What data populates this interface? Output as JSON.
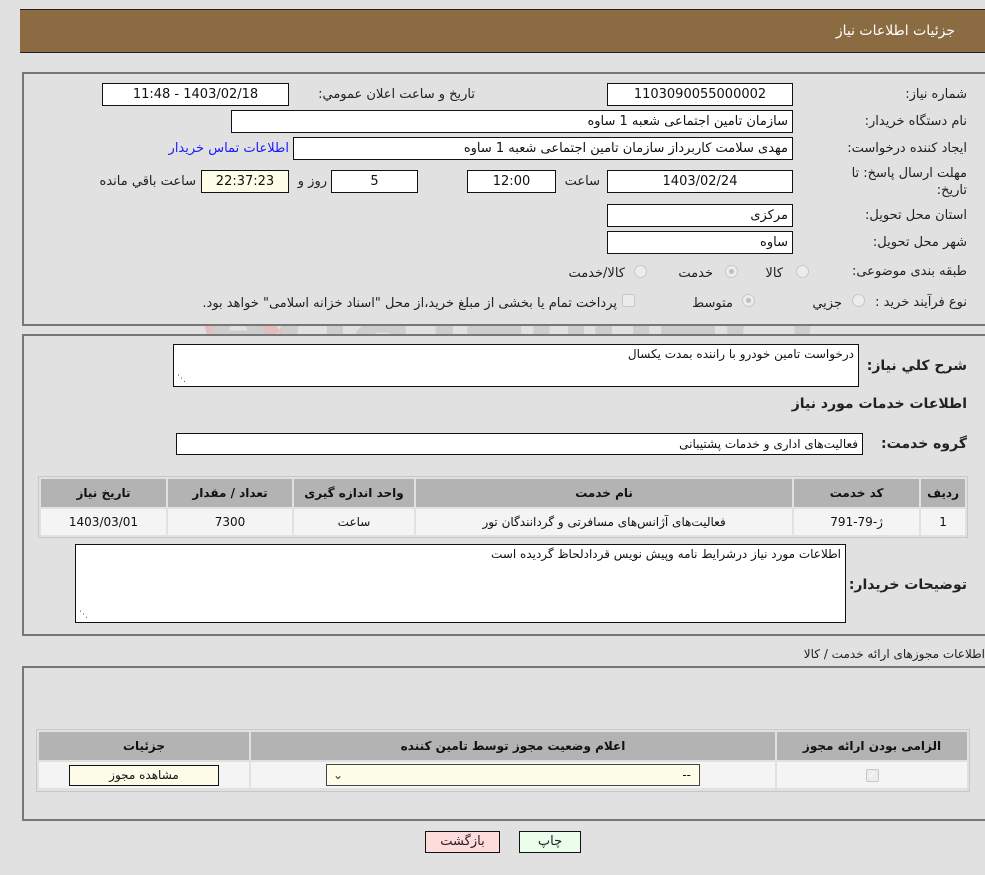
{
  "header": {
    "title": "جزئیات اطلاعات نیاز"
  },
  "details": {
    "need_number_label": "شماره نیاز:",
    "need_number": "1103090055000002",
    "announce_label": "تاریخ و ساعت اعلان عمومي:",
    "announce_value": "1403/02/18 - 11:48",
    "buyer_org_label": "نام دستگاه خریدار:",
    "buyer_org": "سازمان تامین اجتماعی شعبه 1 ساوه",
    "creator_label": "ایجاد کننده درخواست:",
    "creator": "مهدی سلامت کاربرداز سازمان تامین اجتماعی شعبه 1 ساوه",
    "contact_link": "اطلاعات تماس خریدار",
    "deadline_label_1": "مهلت ارسال پاسخ: تا",
    "deadline_label_2": "تاریخ:",
    "deadline_date": "1403/02/24",
    "time_label": "ساعت",
    "deadline_time": "12:00",
    "days_value": "5",
    "days_label": "روز و",
    "remaining_time": "22:37:23",
    "remaining_label": "ساعت باقي مانده",
    "province_label": "استان محل تحویل:",
    "province": "مرکزی",
    "city_label": "شهر محل تحویل:",
    "city": "ساوه",
    "category_label": "طبقه بندی موضوعی:",
    "category_options": [
      {
        "label": "کالا",
        "checked": false
      },
      {
        "label": "خدمت",
        "checked": true
      },
      {
        "label": "کالا/خدمت",
        "checked": false
      }
    ],
    "process_label": "نوع فرآیند خرید :",
    "process_options": [
      {
        "label": "جزيي",
        "checked": false
      },
      {
        "label": "متوسط",
        "checked": true
      }
    ],
    "treasury_note": "پرداخت تمام یا بخشی از مبلغ خرید،از محل \"اسناد خزانه اسلامی\" خواهد بود."
  },
  "summary": {
    "description_label": "شرح کلي نیاز:",
    "description": "درخواست تامین خودرو با راننده بمدت یکسال",
    "services_heading": "اطلاعات خدمات مورد نیاز",
    "service_group_label": "گروه خدمت:",
    "service_group": "فعالیت‌های اداری و خدمات پشتیبانی",
    "table": {
      "headers": [
        "ردیف",
        "کد خدمت",
        "نام خدمت",
        "واحد اندازه گیری",
        "تعداد / مقدار",
        "تاریخ نیاز"
      ],
      "rows": [
        [
          "1",
          "ژ-79-791",
          "فعالیت‌های آژانس‌های مسافرتی و گردانندگان تور",
          "ساعت",
          "7300",
          "1403/03/01"
        ]
      ]
    },
    "buyer_notes_label": "توضیحات خریدار:",
    "buyer_notes": "اطلاعات مورد نیاز درشرایط نامه وپیش نویس قردادلحاظ گردیده است"
  },
  "licenses": {
    "heading": "اطلاعات مجوزهای ارائه خدمت / کالا",
    "headers": [
      "الزامی بودن ارائه مجوز",
      "اعلام وضعیت مجوز توسط تامین کننده",
      "جزئیات"
    ],
    "row": {
      "required_checked": true,
      "status_selected": "--",
      "details_button": "مشاهده مجوز"
    }
  },
  "footer": {
    "back_button": "بازگشت",
    "print_button": "چاپ"
  },
  "watermark": {
    "text": "AriaTender.neT"
  }
}
